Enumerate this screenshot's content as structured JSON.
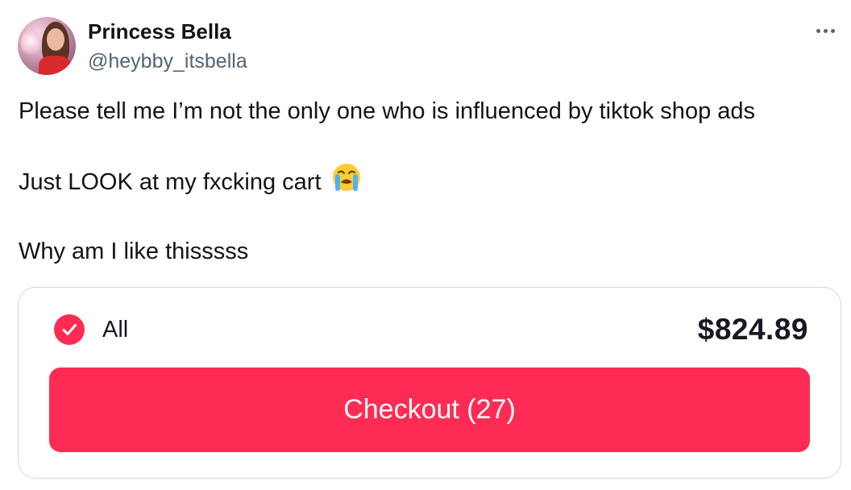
{
  "author": {
    "display_name": "Princess Bella",
    "handle": "@heybby_itsbella",
    "avatar_icon": "profile-photo"
  },
  "tweet": {
    "lines": [
      "Please tell me I’m not the only one who is influenced by tiktok shop ads",
      "Just LOOK at my fxcking cart",
      "Why am I like thisssss"
    ],
    "emoji_icon": "loudly-crying-face-emoji"
  },
  "cart": {
    "select_all_label": "All",
    "select_all_checked": true,
    "total": "$824.89",
    "checkout_label": "Checkout (27)",
    "accent_color": "#fe2c55"
  },
  "more_icon": "more-horizontal-icon"
}
